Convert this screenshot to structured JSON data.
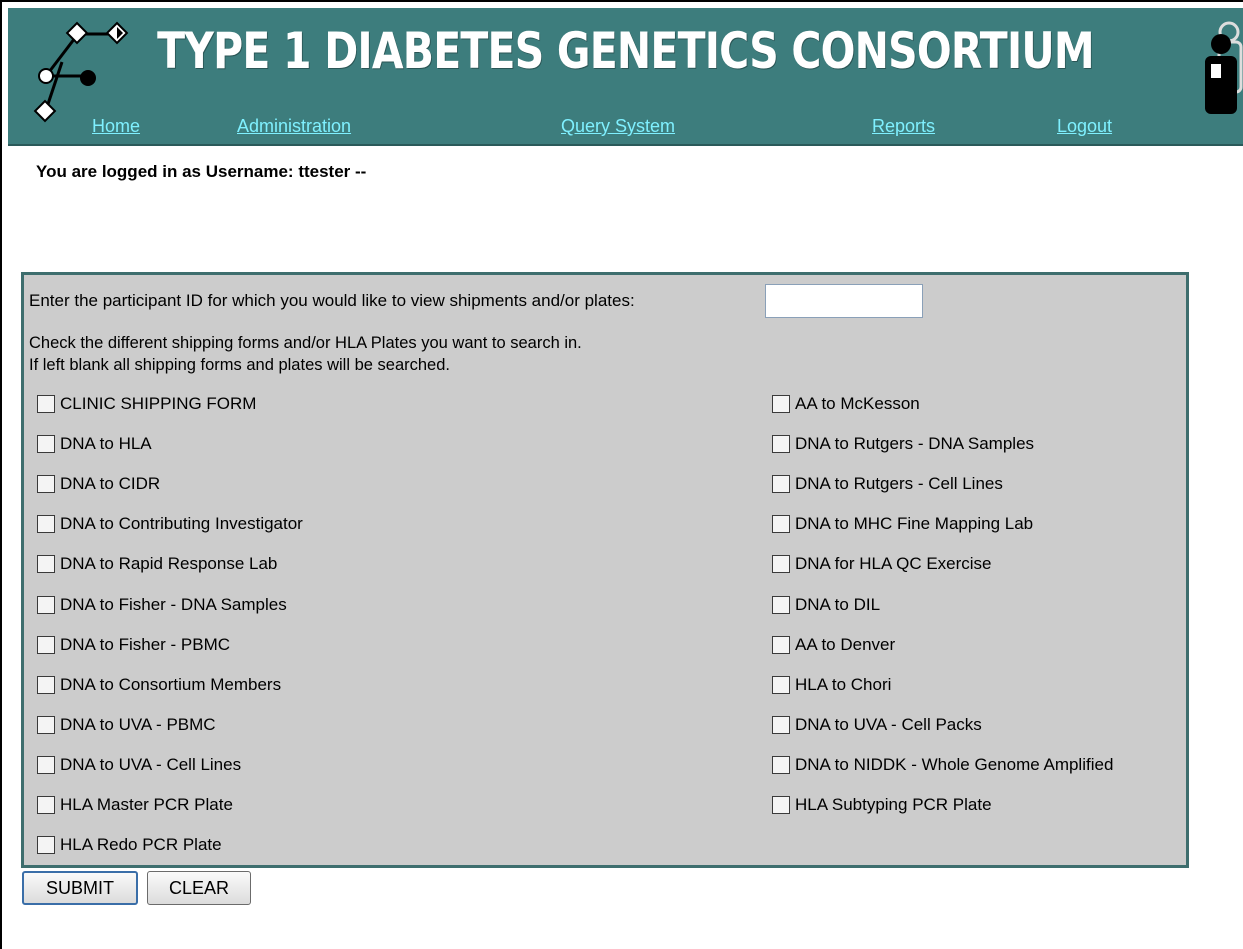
{
  "header": {
    "title": "TYPE 1 DIABETES GENETICS CONSORTIUM",
    "nav": [
      "Home",
      "Administration",
      "Query System",
      "Reports",
      "Logout"
    ]
  },
  "login": {
    "text": "You are logged in as Username:  ttester --"
  },
  "form": {
    "prompt": "Enter the participant ID for which you would like to view shipments and/or plates:",
    "participant_id_value": "",
    "instructions_line1": "Check the different shipping forms and/or HLA Plates you want to search in.",
    "instructions_line2": "If left blank all shipping forms and plates will be searched.",
    "left_options": [
      "CLINIC SHIPPING FORM",
      "DNA to HLA",
      "DNA to CIDR",
      "DNA to Contributing Investigator",
      "DNA to Rapid Response Lab",
      "DNA to Fisher - DNA Samples",
      "DNA to Fisher - PBMC",
      "DNA to Consortium Members",
      "DNA to UVA - PBMC",
      "DNA to UVA - Cell Lines",
      "HLA Master PCR Plate",
      "HLA Redo PCR Plate"
    ],
    "right_options": [
      "AA to McKesson",
      "DNA to Rutgers - DNA Samples",
      "DNA to Rutgers - Cell Lines",
      "DNA to MHC Fine Mapping Lab",
      "DNA for HLA QC Exercise",
      "DNA to DIL",
      "AA to Denver",
      "HLA to Chori",
      "DNA to UVA - Cell Packs",
      "DNA to NIDDK - Whole Genome Amplified",
      "HLA Subtyping PCR Plate"
    ],
    "submit_label": "SUBMIT",
    "clear_label": "CLEAR"
  },
  "colors": {
    "header_bg": "#3d7d7d",
    "nav_link": "#7ff0ff",
    "panel_bg": "#cccccc"
  }
}
